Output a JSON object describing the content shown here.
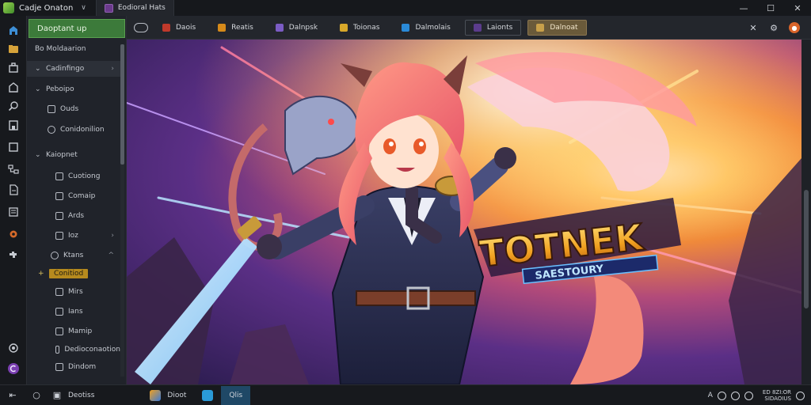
{
  "titlebar": {
    "app_name": "Cadje Onaton",
    "tab_label": "Eodioral Hats"
  },
  "sidebar": {
    "header": "Daoptant up",
    "items": [
      {
        "label": "Bo Moldaarion"
      },
      {
        "label": "Cadinfingo"
      },
      {
        "label": "Peboipo"
      },
      {
        "label": "Ouds"
      },
      {
        "label": "Conidonilion"
      },
      {
        "label": "Kaiopnet"
      },
      {
        "label": "Cuotiong"
      },
      {
        "label": "Comaip"
      },
      {
        "label": "Ards"
      },
      {
        "label": "Ioz"
      },
      {
        "label": "Ktans"
      },
      {
        "label": "Conitiod"
      },
      {
        "label": "Mirs"
      },
      {
        "label": "Ians"
      },
      {
        "label": "Mamip"
      },
      {
        "label": "Dedioconaotion"
      },
      {
        "label": "Dindom"
      }
    ]
  },
  "toolbar": {
    "tabs": [
      {
        "label": "Daois",
        "color": "#c0392b"
      },
      {
        "label": "Reatis",
        "color": "#d68a1a"
      },
      {
        "label": "Dalnpsk",
        "color": "#7b5cc4"
      },
      {
        "label": "Toionas",
        "color": "#d8a82a"
      },
      {
        "label": "Dalmolais",
        "color": "#2a8ad8"
      },
      {
        "label": "Laionts",
        "color": "#5b3c8c"
      },
      {
        "label": "Dalnoat",
        "color": "#c8a04a"
      }
    ]
  },
  "artwork": {
    "logo_title": "TOTNEK",
    "logo_subtitle": "SAESTOURY"
  },
  "bottombar": {
    "start_label": "Deotiss",
    "task1_label": "Dioot",
    "task2_label": "Qlis",
    "clock_line1": "ED 8ZI:OR",
    "clock_line2": "SIDAOIUS"
  }
}
